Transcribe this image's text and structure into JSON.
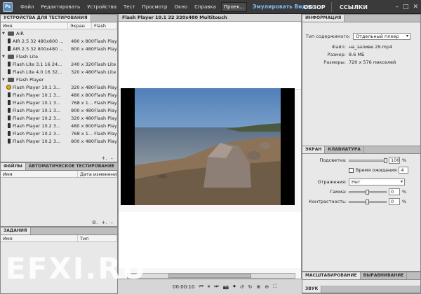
{
  "app": {
    "icon_label": "Ps",
    "menu": [
      "Файл",
      "Редактировать",
      "Устройства",
      "Тест",
      "Просмотр",
      "Окно",
      "Справка"
    ],
    "project_button": "Проек...",
    "emulate_label": "Эмулировать Видео",
    "overview_button": "ОБЗОР",
    "links_button": "ССЫЛКИ",
    "window_controls": [
      "–",
      "□",
      "✕"
    ]
  },
  "devices_panel": {
    "tab": "УСТРОЙСТВА ДЛЯ ТЕСТИРОВАНИЯ",
    "columns": [
      "Имя",
      "Экран",
      "Flash"
    ],
    "groups": [
      {
        "name": "AIR",
        "devices": [
          {
            "name": "AIR 2.5 32 480x800 ...",
            "screen": "480 x 800",
            "profile": "Flash Player"
          },
          {
            "name": "AIR 2.5 32 800x480 ...",
            "screen": "800 x 480",
            "profile": "Flash Player"
          }
        ]
      },
      {
        "name": "Flash Lite",
        "devices": [
          {
            "name": "Flash Lite 3.1 16 24...",
            "screen": "240 x 320",
            "profile": "Flash Lite"
          },
          {
            "name": "Flash Lite 4.0 16 32...",
            "screen": "320 x 480",
            "profile": "Flash Lite"
          }
        ]
      },
      {
        "name": "Flash Player",
        "devices": [
          {
            "name": "Flash Player 10.1 3...",
            "screen": "320 x 480",
            "profile": "Flash Player",
            "warning": true
          },
          {
            "name": "Flash Player 10.1 3...",
            "screen": "480 x 800",
            "profile": "Flash Player"
          },
          {
            "name": "Flash Player 10.1 3...",
            "screen": "768 x 1...",
            "profile": "Flash Player"
          },
          {
            "name": "Flash Player 10.1 3...",
            "screen": "800 x 480",
            "profile": "Flash Player"
          },
          {
            "name": "Flash Player 10.2 3...",
            "screen": "320 x 480",
            "profile": "Flash Player"
          },
          {
            "name": "Flash Player 10.2 3...",
            "screen": "480 x 800",
            "profile": "Flash Player"
          },
          {
            "name": "Flash Player 10.2 3...",
            "screen": "768 x 1...",
            "profile": "Flash Player"
          },
          {
            "name": "Flash Player 10.2 3...",
            "screen": "800 x 480",
            "profile": "Flash Player"
          }
        ]
      }
    ],
    "footer_icons": [
      "+.",
      "–"
    ]
  },
  "files_panel": {
    "tabs": [
      "ФАЙЛЫ",
      "АВТОМАТИЧЕСКОЕ ТЕСТИРОВАНИЕ"
    ],
    "columns": [
      "Имя",
      "Дата изменения"
    ],
    "footer_icons": [
      "⚙.",
      "+.",
      "–"
    ]
  },
  "tasks_panel": {
    "tab": "ЗАДАНИЯ",
    "columns": [
      "Имя",
      "Тип"
    ]
  },
  "document": {
    "tab": "Flash Player 10.1 32 320x480 Multitouch"
  },
  "playback": {
    "time": "00:00:10",
    "controls": [
      "⏮",
      "⏸",
      "⏭",
      "📷",
      "⏺",
      "↺",
      "↻",
      "⊕",
      "⊖",
      "⛶"
    ]
  },
  "info_panel": {
    "tab": "ИНФОРМАЦИЯ",
    "content_type_label": "Тип содержимого:",
    "content_type_value": "Отдельный плеер",
    "file_label": "Файл:",
    "file_value": "на_заливе 29.mp4",
    "size_label": "Размер:",
    "size_value": "8.6 МБ",
    "dims_label": "Размеры:",
    "dims_value": "720 x 576 пикселей"
  },
  "screen_panel": {
    "tabs": [
      "ЭКРАН",
      "КЛАВИАТУРА"
    ],
    "backlight_label": "Подсветка:",
    "backlight_value": "100",
    "backlight_level": 1.0,
    "timeout_label": "Время ожидания",
    "timeout_value": "4",
    "reflection_label": "Отражения:",
    "reflection_value": "Нет",
    "gamma_label": "Гамма:",
    "gamma_value": "0",
    "gamma_level": 0.5,
    "contrast_label": "Контрастность:",
    "contrast_value": "0",
    "contrast_level": 0.5,
    "percent": "%"
  },
  "scale_panel": {
    "tabs": [
      "МАСШТАБИРОВАНИЕ",
      "ВЫРАВНИВАНИЕ"
    ],
    "second_tab": "ЗВУК"
  },
  "watermark": "EFXI.RU",
  "colors": {
    "topbar": "#3a3a3a",
    "accent_blue": "#7db8f0",
    "panel_bg": "#e8e8e8"
  }
}
